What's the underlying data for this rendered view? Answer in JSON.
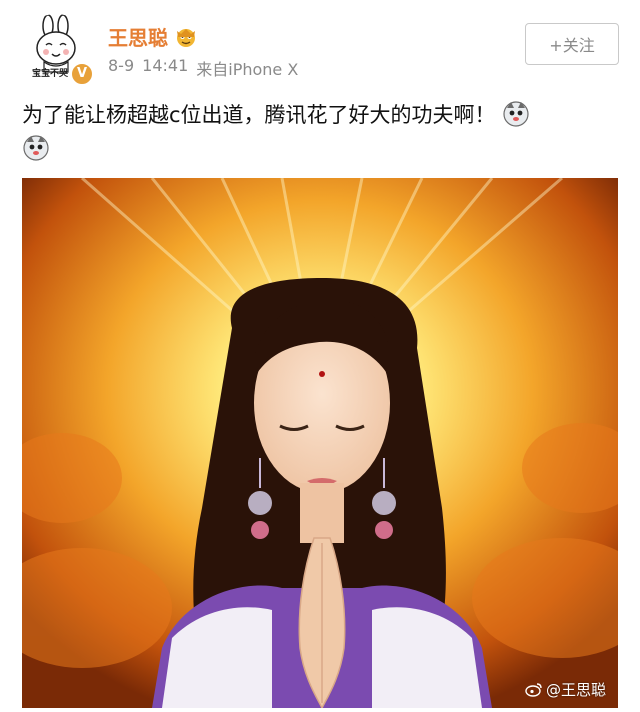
{
  "post": {
    "avatar": {
      "caption": "宝宝不哭",
      "icon": "rabbit-avatar-icon"
    },
    "verified": {
      "symbol": "V",
      "color": "#e8a13a"
    },
    "username": "王思聪",
    "username_color": "#e57e34",
    "crown_icon": "crown-icon",
    "date": "8-9",
    "time": "14:41",
    "source": "来自iPhone X",
    "follow_label": "+关注",
    "text": "为了能让杨超越c位出道，腾讯花了好大的功夫啊！",
    "emoji_icons": [
      "husky-emoji-icon",
      "husky-emoji-icon"
    ],
    "image": {
      "subject": "praying-girl-image",
      "watermark": "@王思聪",
      "watermark_icon": "weibo-icon"
    }
  }
}
